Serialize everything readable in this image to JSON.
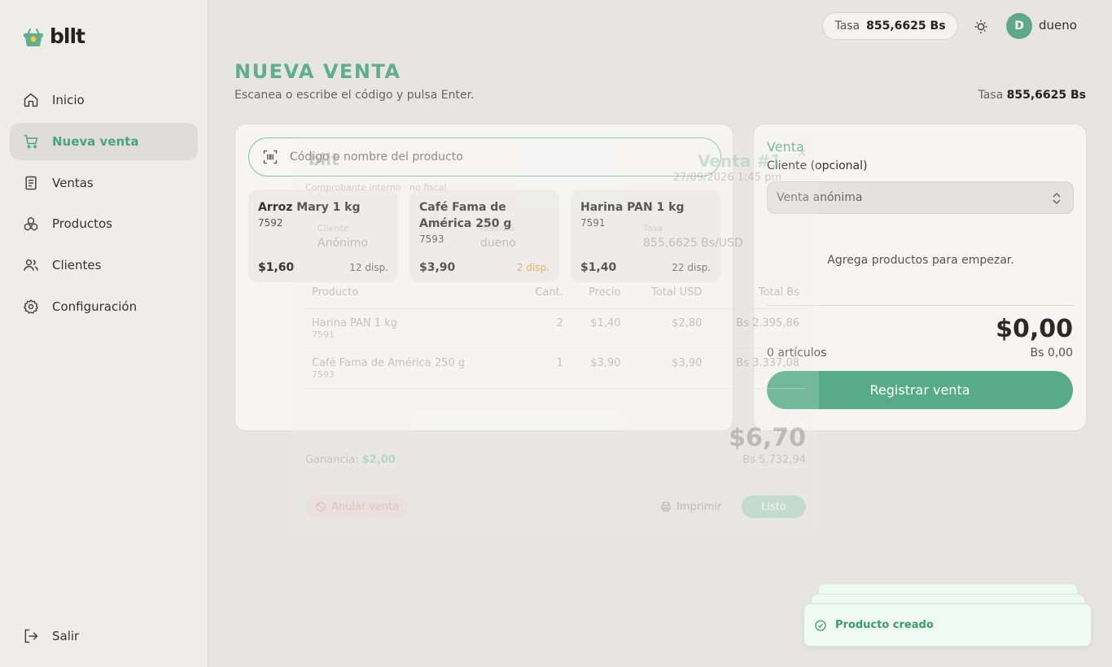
{
  "app": {
    "logo_text": "bllt"
  },
  "sidebar": {
    "items": [
      {
        "label": "Inicio",
        "icon": "home-icon"
      },
      {
        "label": "Nueva venta",
        "icon": "cart-icon",
        "active": true
      },
      {
        "label": "Ventas",
        "icon": "receipt-icon"
      },
      {
        "label": "Productos",
        "icon": "boxes-icon"
      },
      {
        "label": "Clientes",
        "icon": "users-icon"
      },
      {
        "label": "Configuración",
        "icon": "gear-icon"
      }
    ],
    "logout_label": "Salir"
  },
  "topbar": {
    "rate_label": "Tasa",
    "rate_value": "855,6625 Bs",
    "avatar_initial": "D",
    "username": "dueno"
  },
  "header": {
    "title": "NUEVA VENTA",
    "subtitle": "Escanea o escribe el código y pulsa Enter.",
    "rate_label": "Tasa",
    "rate_value": "855,6625 Bs"
  },
  "search": {
    "placeholder": "Código o nombre del producto"
  },
  "products": [
    {
      "name": "Arroz Mary 1 kg",
      "code": "7592",
      "price": "$1,60",
      "stock": "12 disp.",
      "low": false
    },
    {
      "name": "Café Fama de América 250 g",
      "code": "7593",
      "price": "$3,90",
      "stock": "2 disp.",
      "low": true
    },
    {
      "name": "Harina PAN 1 kg",
      "code": "7591",
      "price": "$1,40",
      "stock": "22 disp.",
      "low": false
    }
  ],
  "sale": {
    "title": "Venta",
    "client_label": "Cliente (opcional)",
    "client_value": "Venta anónima",
    "empty_message": "Agrega productos para empezar.",
    "total_usd": "$0,00",
    "items_count": "0 artículos",
    "total_bs": "Bs 0,00",
    "register_label": "Registrar venta"
  },
  "receipt": {
    "logo_text": "bllt",
    "subtitle": "Comprobante interno · no fiscal",
    "title": "Venta #1",
    "date": "27/09/2026 1:45 pm",
    "close": "×",
    "client_key": "Cliente",
    "client_value": "Anónimo",
    "attended_key": "Atendió",
    "attended_value": "dueno",
    "rate_key": "Tasa",
    "rate_value": "855,6625 Bs/USD",
    "columns": [
      "Producto",
      "Cant.",
      "Precio",
      "Total USD",
      "Total Bs"
    ],
    "rows": [
      {
        "name": "Harina PAN 1 kg",
        "code": "7591",
        "qty": "2",
        "price": "$1,40",
        "total_usd": "$2,80",
        "total_bs": "Bs 2.395,86"
      },
      {
        "name": "Café Fama de América 250 g",
        "code": "7593",
        "qty": "1",
        "price": "$3,90",
        "total_usd": "$3,90",
        "total_bs": "Bs 3.337,08"
      }
    ],
    "total_usd": "$6,70",
    "total_bs": "Bs 5.732,94",
    "gain_label": "Ganancia:",
    "gain_value": "$2,00",
    "void_label": "Anular venta",
    "print_label": "Imprimir",
    "done_label": "Listo"
  },
  "toast": {
    "message": "Producto creado"
  },
  "colors": {
    "accent": "#58ab88",
    "warning": "#e5a43a"
  }
}
